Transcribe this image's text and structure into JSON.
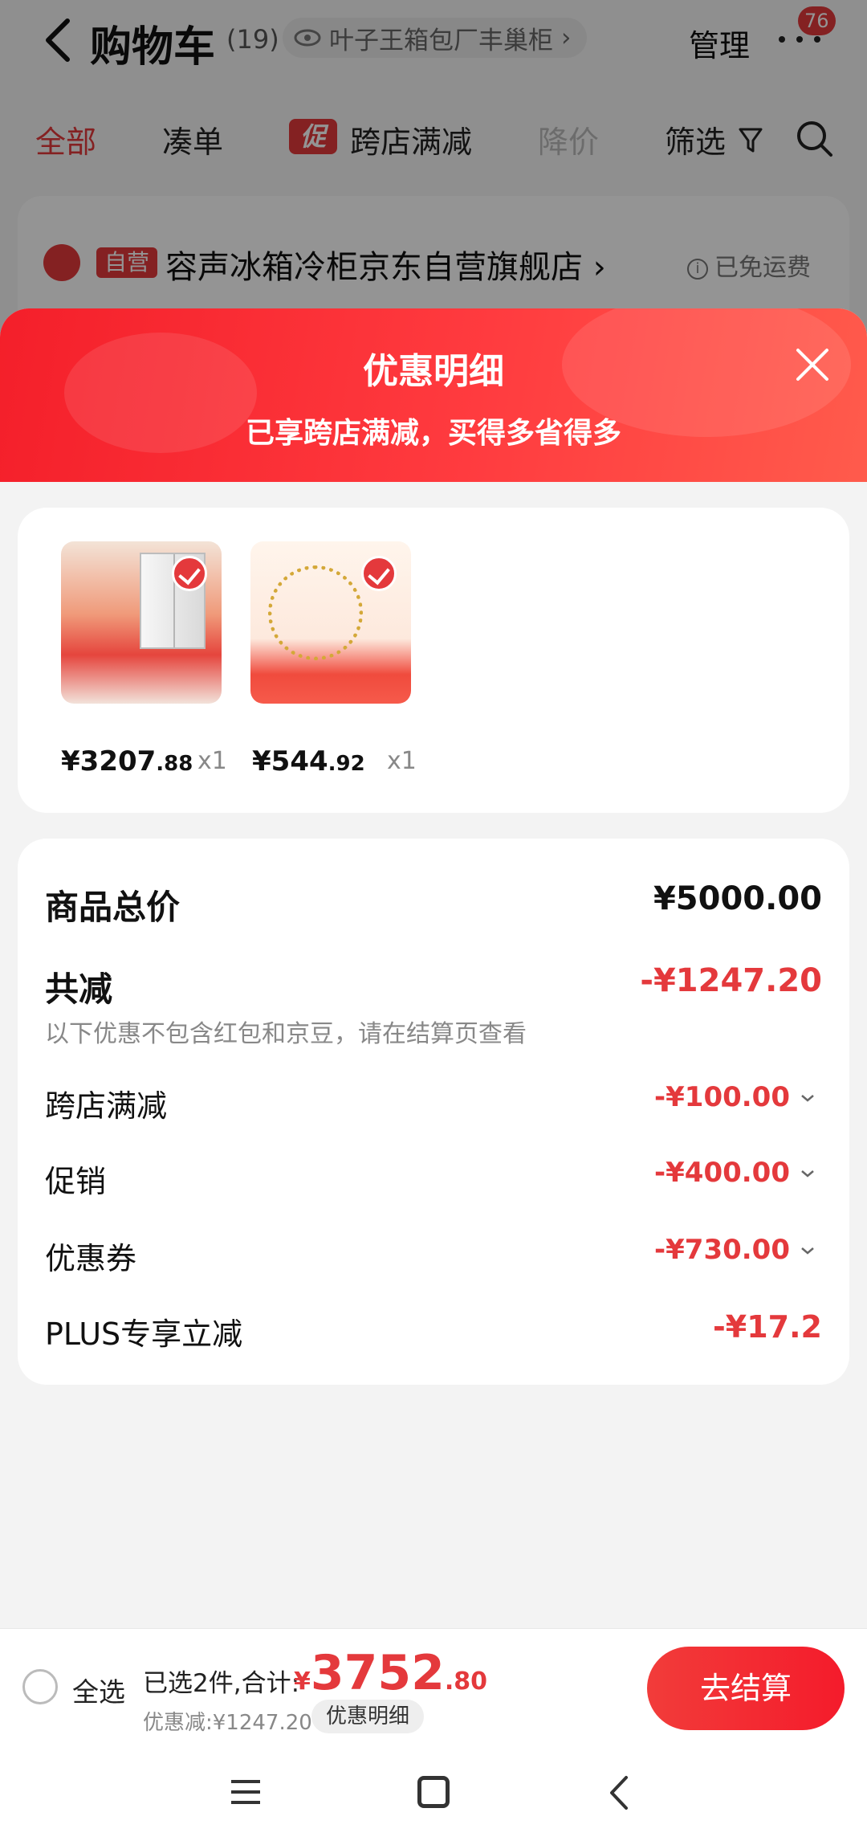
{
  "header": {
    "title": "购物车",
    "count": "(19)",
    "address": "叶子王箱包厂丰巢柜",
    "address_arrow": "›",
    "manage": "管理",
    "badge": "76"
  },
  "filters": {
    "all": "全部",
    "cou": "凑单",
    "promo_tag": "促",
    "cross_store": "跨店满减",
    "price_drop": "降价",
    "screen": "筛选"
  },
  "store": {
    "self_tag": "自营",
    "name": "容声冰箱冷柜京东自营旗舰店 ›",
    "shipping_icon": "i",
    "shipping": "已免运费"
  },
  "sheet": {
    "title": "优惠明细",
    "subtitle": "已享跨店满减，买得多省得多"
  },
  "products": [
    {
      "price_int": "¥3207",
      "price_dec": ".88",
      "qty": "x1"
    },
    {
      "price_int": "¥544",
      "price_dec": ".92",
      "qty": "x1"
    }
  ],
  "details": {
    "goods_total_label": "商品总价",
    "goods_total_value": "¥5000.00",
    "total_reduce_label": "共减",
    "total_reduce_value": "-¥1247.20",
    "note": "以下优惠不包含红包和京豆，请在结算页查看",
    "items": [
      {
        "label": "跨店满减",
        "value": "-¥100.00"
      },
      {
        "label": "促销",
        "value": "-¥400.00"
      },
      {
        "label": "优惠券",
        "value": "-¥730.00"
      },
      {
        "label": "PLUS专享立减",
        "value": "-¥17.2"
      }
    ]
  },
  "checkout": {
    "select_all": "全选",
    "selected": "已选2件,合计:",
    "currency": "¥",
    "total_int": "3752",
    "total_dec": ".80",
    "discount": "优惠减:¥1247.20",
    "detail_chip": "优惠明细",
    "button": "去结算"
  },
  "colors": {
    "accent": "#e4393c",
    "sheet_header": "#ff3b3f"
  }
}
